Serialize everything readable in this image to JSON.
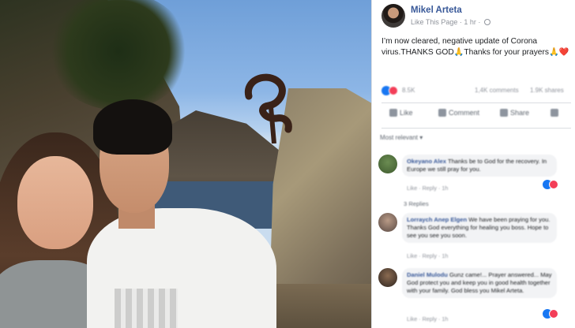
{
  "photo": {
    "description_alt": ""
  },
  "post": {
    "page_name": "Mikel Arteta",
    "like_page_link": "Like This Page",
    "time_ago": "1 hr",
    "text": "I’m now cleared, negative update of Corona virus.THANKS GOD🙏Thanks for your prayers🙏❤️"
  },
  "stats": {
    "reaction_count": "8.5K",
    "comments": "1,4K comments",
    "shares": "1.9K shares"
  },
  "actions": {
    "like": "Like",
    "comment": "Comment",
    "share": "Share"
  },
  "sort_label": "Most relevant",
  "comments": [
    {
      "author": "Okeyano Alex",
      "text": "Thanks be to God for the recovery. In Europe we still pray for you.",
      "actions": "Like · Reply · 1h"
    },
    {
      "author": "Lorraych Anep Elgen",
      "text": "We have been praying for you. Thanks God everything for healing you boss. Hope to see you see you soon.",
      "actions": "Like · Reply · 1h"
    },
    {
      "author": "Daniel Mulodu",
      "text": "Gunz came!... Prayer answered... May God protect you and keep you in good health together with your family. God bless you Mikel Arteta.",
      "actions": "Like · Reply · 1h"
    }
  ],
  "replies_label": "3 Replies",
  "icons": {
    "globe": "globe-icon",
    "like": "like-icon",
    "comment": "comment-icon",
    "share": "share-icon",
    "more": "more-icon"
  }
}
